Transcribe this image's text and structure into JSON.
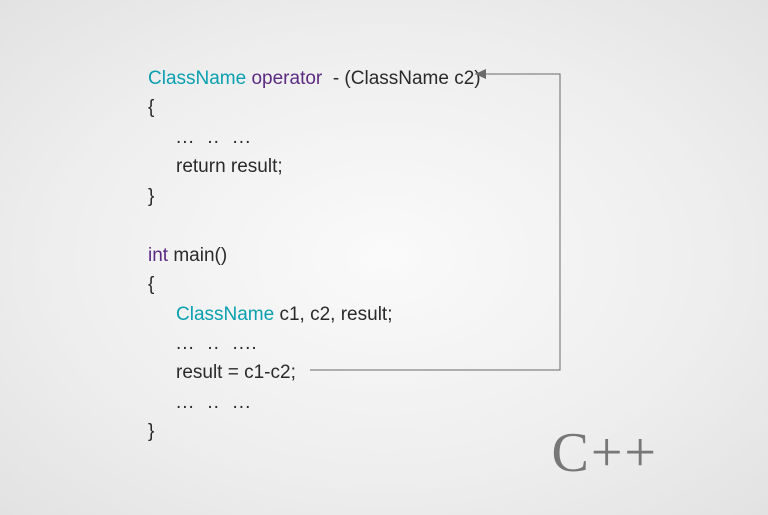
{
  "code": {
    "l1_class": "ClassName",
    "l1_op": "operator",
    "l1_rest": "  - (ClassName c2)",
    "l2": "{",
    "l3": "...  ..  ...",
    "l4": "return result;",
    "l5": "}",
    "l6_int": "int",
    "l6_main": " main()",
    "l7": "{",
    "l8_class": "ClassName",
    "l8_rest": " c1, c2, result;",
    "l9": "...  ..  ....",
    "l10": "result = c1-c2;",
    "l11": "...  ..  ...",
    "l12": "}"
  },
  "language_label": "C++"
}
